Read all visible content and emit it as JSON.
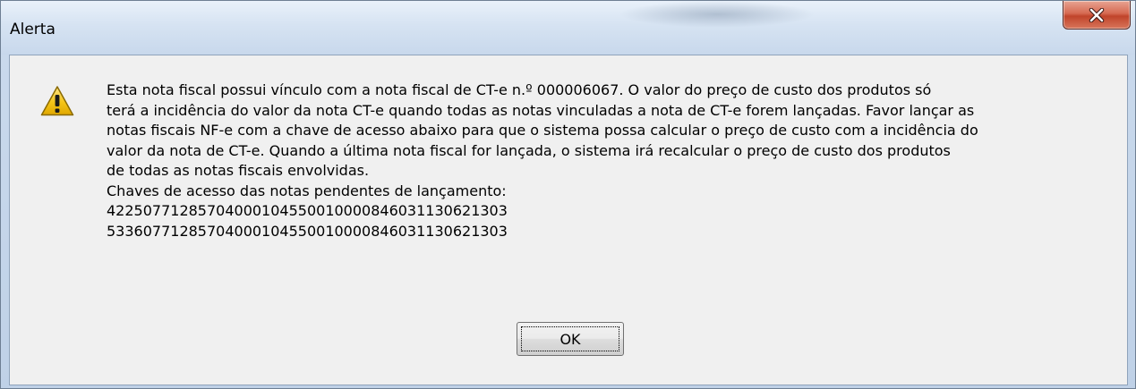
{
  "window": {
    "title": "Alerta",
    "close_icon": "close-icon"
  },
  "dialog": {
    "icon": "warning-icon",
    "message_lines": [
      "Esta nota fiscal possui vínculo com a nota fiscal de CT-e n.º 000006067. O valor do preço de custo dos produtos só",
      "terá a incidência do valor da nota CT-e quando todas as notas vinculadas a nota de CT-e forem lançadas. Favor lançar as",
      "notas fiscais NF-e com a chave de acesso abaixo para que o sistema possa calcular o preço de custo com a incidência do",
      "valor da nota de CT-e. Quando a última nota fiscal for lançada, o sistema irá recalcular o preço de custo dos produtos",
      "de todas as notas fiscais envolvidas.",
      "Chaves de acesso das notas pendentes de lançamento:",
      "42250771285704000104550010000846031130621303",
      "53360771285704000104550010000846031130621303"
    ],
    "ok_label": "OK"
  },
  "colors": {
    "close_button": "#c9503a",
    "panel_background": "#f0f0f0",
    "warning_fill": "#f5c518"
  }
}
